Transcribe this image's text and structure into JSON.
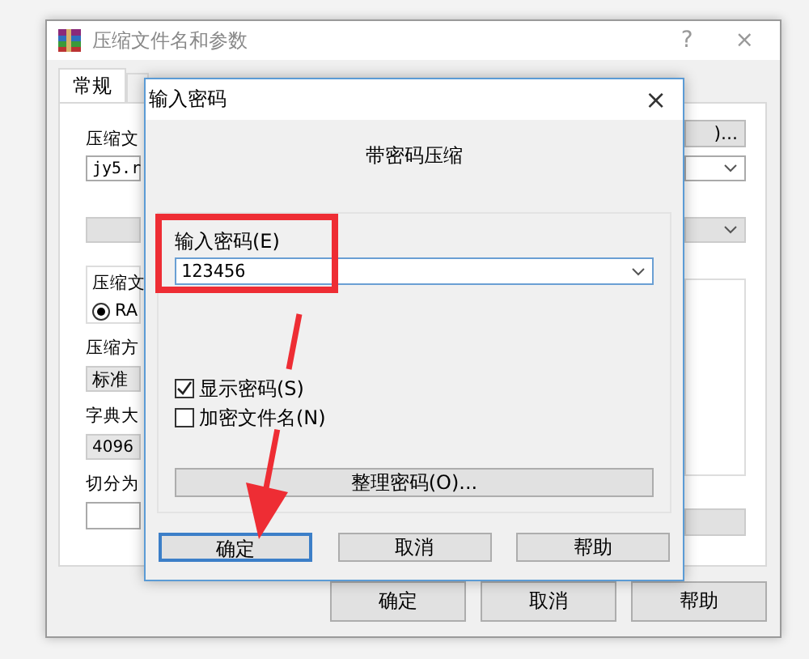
{
  "back_window": {
    "title": "压缩文件名和参数",
    "help_glyph": "?",
    "close_glyph": "×",
    "tabs": [
      {
        "label": "常规",
        "selected": true
      }
    ],
    "archive_label": "压缩文",
    "archive_name": "jy5.r",
    "browse_button": ")...",
    "format_group_label": "压缩文",
    "format_option": {
      "label": "RA",
      "selected": true
    },
    "method_label": "压缩方",
    "method_value": "标准",
    "dictionary_label": "字典大",
    "dictionary_value": "4096",
    "split_label": "切分为",
    "buttons": [
      "确定",
      "取消",
      "帮助"
    ]
  },
  "dialog": {
    "title": "输入密码",
    "close_glyph": "×",
    "heading": "带密码压缩",
    "password_label": "输入密码(E)",
    "password_value": "123456",
    "options": [
      {
        "label": "显示密码(S)",
        "checked": true
      },
      {
        "label": "加密文件名(N)",
        "checked": false
      }
    ],
    "organize_button": "整理密码(O)...",
    "buttons": [
      {
        "label": "确定",
        "focused": true
      },
      {
        "label": "取消",
        "focused": false
      },
      {
        "label": "帮助",
        "focused": false
      }
    ]
  }
}
